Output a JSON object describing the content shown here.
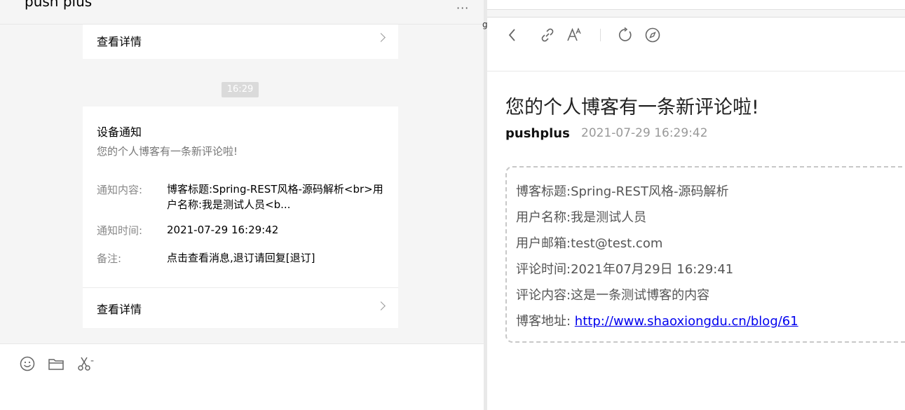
{
  "chat": {
    "title": "push plus",
    "more_glyph": "···",
    "top_card": {
      "detail_label": "查看详情"
    },
    "time_chip": "16:29",
    "notice_card": {
      "title": "设备通知",
      "subtitle": "您的个人博客有一条新评论啦!",
      "fields": [
        {
          "key": "通知内容:",
          "value": "博客标题:Spring-REST风格-源码解析<br>用户名称:我是测试人员<b..."
        },
        {
          "key": "通知时间:",
          "value": "2021-07-29 16:29:42"
        },
        {
          "key": "备注:",
          "value": "点击查看消息,退订请回复[退订]"
        }
      ],
      "detail_label": "查看详情"
    },
    "toolbar_icons": [
      "emoji-icon",
      "folder-icon",
      "scissors-icon"
    ],
    "scissor_suffix": "-"
  },
  "split_char": "g",
  "article": {
    "title": "您的个人博客有一条新评论啦!",
    "author": "pushplus",
    "date": "2021-07-29 16:29:42",
    "lines": [
      "博客标题:Spring-REST风格-源码解析",
      "用户名称:我是测试人员",
      "用户邮箱:test@test.com",
      "评论时间:2021年07月29日 16:29:41",
      "评论内容:这是一条测试博客的内容"
    ],
    "link_prefix": "博客地址: ",
    "link_text": "http://www.shaoxiongdu.cn/blog/61"
  },
  "browser_toolbar_icons": [
    "back-icon",
    "link-icon",
    "font-size-icon",
    "refresh-icon",
    "compass-icon"
  ]
}
